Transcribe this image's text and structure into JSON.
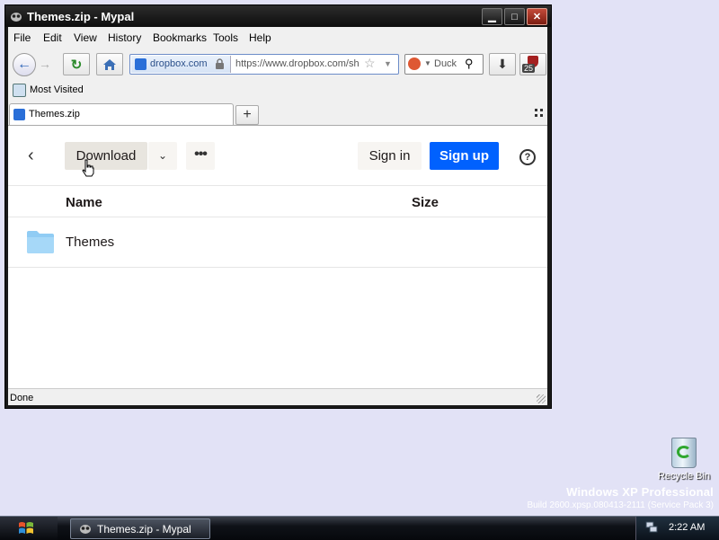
{
  "window": {
    "title": "Themes.zip - Mypal",
    "controls": {
      "minimize": "▁",
      "maximize": "□",
      "close": "✕"
    }
  },
  "menubar": {
    "items": [
      {
        "label": "File"
      },
      {
        "label": "Edit"
      },
      {
        "label": "View"
      },
      {
        "label": "History"
      },
      {
        "label": "Bookmarks"
      },
      {
        "label": "Tools"
      },
      {
        "label": "Help"
      }
    ]
  },
  "navbar": {
    "domain": "dropbox.com",
    "url": "https://www.dropbox.com/sh",
    "search_text": "Duck",
    "extension_badge": "25"
  },
  "bookmarks": {
    "items": [
      {
        "label": "Most Visited"
      }
    ]
  },
  "tabs": [
    {
      "label": "Themes.zip"
    }
  ],
  "page": {
    "download_label": "Download",
    "signin_label": "Sign in",
    "signup_label": "Sign up",
    "help_glyph": "?",
    "more_glyph": "•••",
    "columns": {
      "name": "Name",
      "size": "Size"
    },
    "files": [
      {
        "name": "Themes",
        "size": ""
      }
    ]
  },
  "status": {
    "text": "Done"
  },
  "desktop": {
    "recycle_bin_label": "Recycle Bin",
    "watermark_line1": "Windows XP Professional",
    "watermark_line2": "Build 2600.xpsp.080413-2111 (Service Pack 3)"
  },
  "taskbar": {
    "task_label": "Themes.zip - Mypal",
    "clock": "2:22 AM"
  },
  "colors": {
    "desktop_bg": "#e2e2f6",
    "signup_blue": "#0061fe",
    "folder_blue": "#90ccf4"
  }
}
